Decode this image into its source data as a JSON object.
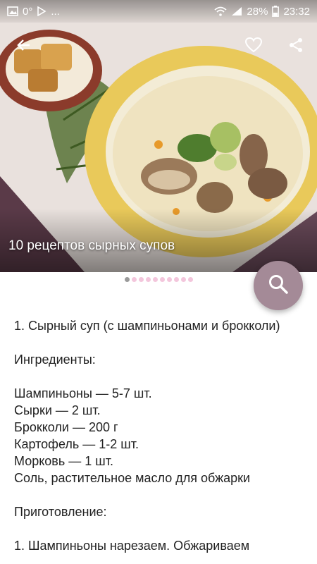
{
  "status_bar": {
    "left_text": "0°",
    "ellipsis": "...",
    "battery": "28%",
    "time": "23:32",
    "icons": [
      "gallery-icon",
      "play-store-icon",
      "wifi-icon",
      "signal-icon",
      "battery-icon"
    ]
  },
  "hero": {
    "title": "10 рецептов сырных супов",
    "page_count": 10,
    "active_page": 1
  },
  "toolbar": {
    "icons": [
      "back-arrow-icon",
      "heart-icon",
      "share-icon"
    ]
  },
  "fab": {
    "icon": "search-icon",
    "color": "#a48a97"
  },
  "colors": {
    "dot_active": "#9a9a9a",
    "dot_inactive": "#f3c6dc"
  },
  "article": {
    "heading": "1. Сырный суп (с шампиньонами и брокколи)",
    "ingredients_title": "Ингредиенты:",
    "ingredients": [
      "Шампиньоны — 5-7 шт.",
      "Сырки — 2 шт.",
      "Брокколи — 200 г",
      "Картофель — 1-2 шт.",
      "Морковь — 1 шт.",
      "Соль, растительное масло для обжарки"
    ],
    "preparation_title": "Приготовление:",
    "step1": "1. Шампиньоны нарезаем. Обжариваем"
  }
}
